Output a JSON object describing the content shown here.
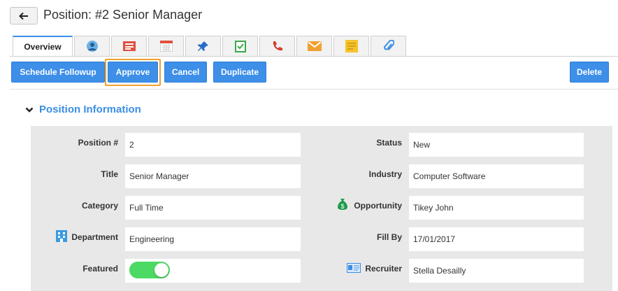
{
  "header": {
    "title": "Position: #2 Senior Manager"
  },
  "tabs": [
    {
      "label": "Overview",
      "icon": "overview"
    },
    {
      "icon": "contacts-icon"
    },
    {
      "icon": "list-icon"
    },
    {
      "icon": "calendar-icon"
    },
    {
      "icon": "pin-icon"
    },
    {
      "icon": "task-icon"
    },
    {
      "icon": "phone-icon"
    },
    {
      "icon": "email-icon"
    },
    {
      "icon": "note-icon"
    },
    {
      "icon": "attachment-icon"
    }
  ],
  "actions": {
    "schedule_followup": "Schedule Followup",
    "approve": "Approve",
    "cancel": "Cancel",
    "duplicate": "Duplicate",
    "delete": "Delete"
  },
  "section": {
    "title": "Position Information"
  },
  "fields": {
    "position_no": {
      "label": "Position #",
      "value": "2"
    },
    "title": {
      "label": "Title",
      "value": "Senior Manager"
    },
    "category": {
      "label": "Category",
      "value": "Full Time"
    },
    "department": {
      "label": "Department",
      "value": "Engineering"
    },
    "featured": {
      "label": "Featured",
      "value": "on"
    },
    "status": {
      "label": "Status",
      "value": "New"
    },
    "industry": {
      "label": "Industry",
      "value": "Computer Software"
    },
    "opportunity": {
      "label": "Opportunity",
      "value": "Tikey John"
    },
    "fill_by": {
      "label": "Fill By",
      "value": "17/01/2017"
    },
    "recruiter": {
      "label": "Recruiter",
      "value": "Stella Desailly"
    }
  },
  "colors": {
    "accent": "#3d8fe8",
    "highlight": "#f0a030",
    "toggle_on": "#4cd964"
  }
}
